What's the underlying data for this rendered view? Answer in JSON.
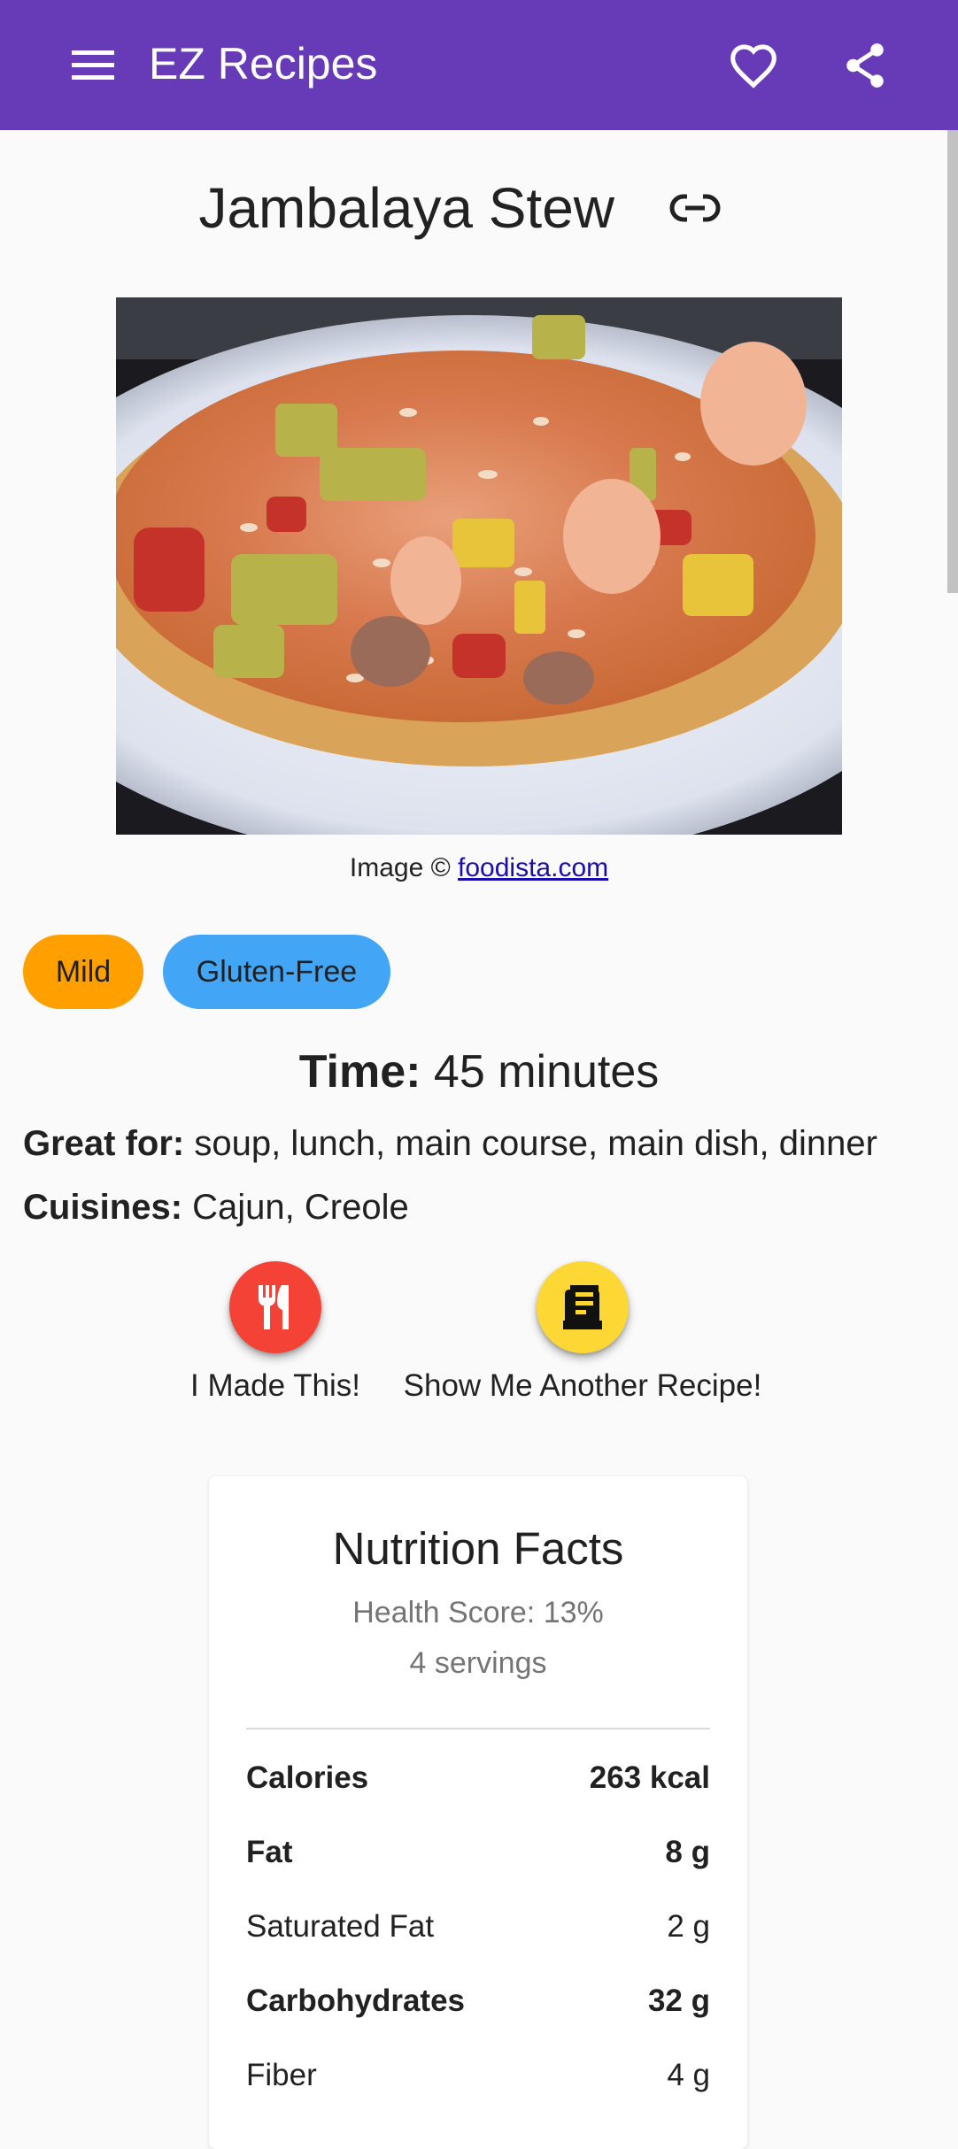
{
  "app_bar": {
    "title": "EZ Recipes",
    "background": "#673ab7",
    "icons": [
      "menu-icon",
      "heart-outline-icon",
      "share-icon"
    ]
  },
  "recipe": {
    "title": "Jambalaya Stew",
    "image_credit_prefix": "Image © ",
    "image_credit_link": "foodista.com",
    "chips": [
      {
        "label": "Mild",
        "color": "#ffa000"
      },
      {
        "label": "Gluten-Free",
        "color": "#42a5f5"
      }
    ],
    "time_label": "Time:",
    "time_value": " 45 minutes",
    "great_for_label": "Great for:",
    "great_for_value": " soup, lunch, main course, main dish, dinner",
    "cuisines_label": "Cuisines:",
    "cuisines_value": " Cajun, Creole"
  },
  "actions": {
    "made_this": {
      "label": "I Made This!",
      "icon": "fork-knife-icon",
      "color": "#f44336"
    },
    "another": {
      "label": "Show Me Another Recipe!",
      "icon": "receipt-icon",
      "color": "#fdd835"
    }
  },
  "nutrition": {
    "title": "Nutrition Facts",
    "health_score": "Health Score: 13%",
    "servings": "4 servings",
    "rows": [
      {
        "name": "Calories",
        "value": "263 kcal",
        "bold": true
      },
      {
        "name": "Fat",
        "value": "8 g",
        "bold": true
      },
      {
        "name": "Saturated Fat",
        "value": "2 g",
        "bold": false
      },
      {
        "name": "Carbohydrates",
        "value": "32 g",
        "bold": true
      },
      {
        "name": "Fiber",
        "value": "4 g",
        "bold": false
      }
    ]
  }
}
